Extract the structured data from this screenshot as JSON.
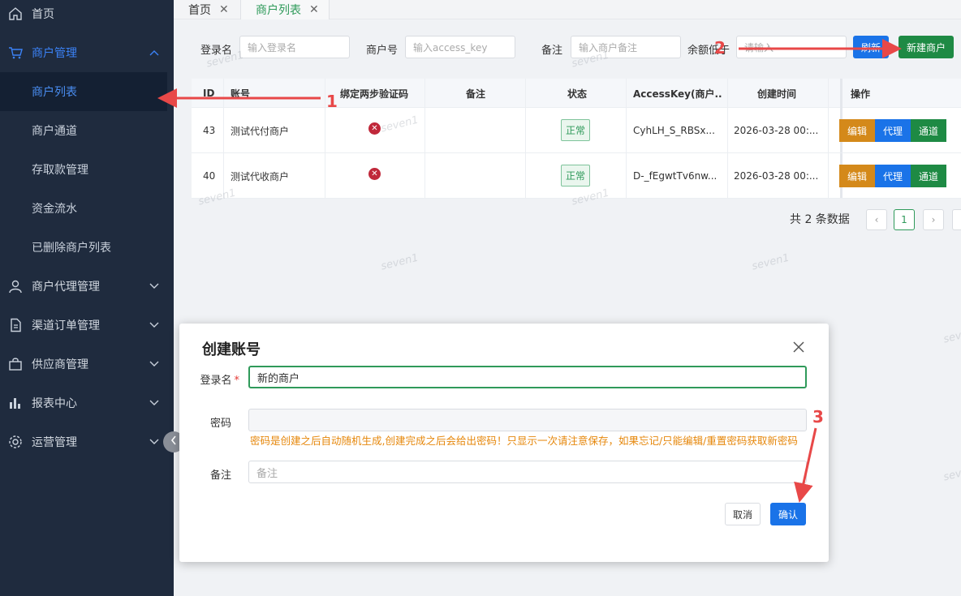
{
  "sidebar": {
    "items": [
      {
        "label": "首页",
        "icon": "home-icon"
      },
      {
        "label": "商户管理",
        "icon": "cart-icon"
      },
      {
        "label": "商户代理管理",
        "icon": "user-icon"
      },
      {
        "label": "渠道订单管理",
        "icon": "document-icon"
      },
      {
        "label": "供应商管理",
        "icon": "bag-icon"
      },
      {
        "label": "报表中心",
        "icon": "bar-chart-icon"
      },
      {
        "label": "运营管理",
        "icon": "gear-icon"
      }
    ],
    "sub_items": [
      "商户列表",
      "商户通道",
      "存取款管理",
      "资金流水",
      "已删除商户列表"
    ],
    "active_color": "#3b82f6",
    "bg_color": "#1f2b3e"
  },
  "tabs": [
    {
      "label": "首页",
      "close": "✕"
    },
    {
      "label": "商户列表",
      "close": "✕"
    }
  ],
  "filters": {
    "login_name": {
      "label": "登录名",
      "placeholder": "输入登录名"
    },
    "merchant_no": {
      "label": "商户号",
      "placeholder": "输入access_key"
    },
    "remark": {
      "label": "备注",
      "placeholder": "输入商户备注"
    },
    "balance": {
      "label": "余额低于",
      "placeholder": "请输入"
    },
    "refresh_label": "刷新",
    "new_label": "新建商户"
  },
  "table": {
    "headers": [
      "ID",
      "账号",
      "绑定两步验证码",
      "备注",
      "状态",
      "AccessKey(商户...",
      "创建时间",
      "操作"
    ],
    "rows": [
      {
        "id": "43",
        "account": "测试代付商户",
        "remark": "",
        "status": "正常",
        "access_key": "CyhLH_S_RBSx...",
        "created": "2026-03-28 00:..."
      },
      {
        "id": "40",
        "account": "测试代收商户",
        "remark": "",
        "status": "正常",
        "access_key": "D-_fEgwtTv6nw...",
        "created": "2026-03-28 00:..."
      }
    ],
    "actions": [
      "编辑",
      "代理",
      "通道"
    ]
  },
  "pager": {
    "total": "共 2 条数据",
    "prev": "‹",
    "current": "1",
    "next": "›"
  },
  "watermark": "seven1",
  "modal": {
    "title": "创建账号",
    "login_label": "登录名",
    "required_mark": "*",
    "login_value": "新的商户",
    "password_label": "密码",
    "password_hint": "密码是创建之后自动随机生成,创建完成之后会给出密码！只显示一次请注意保存，如果忘记/只能编辑/重置密码获取新密码",
    "remark_label": "备注",
    "remark_placeholder": "备注",
    "cancel_label": "取消",
    "confirm_label": "确认"
  },
  "annotations": [
    "1",
    "2",
    "3"
  ],
  "colors": {
    "primary": "#1a73e8",
    "success": "#1e8a44",
    "warning": "#d4891a",
    "danger": "#c0283a",
    "annotation": "#e84848"
  }
}
